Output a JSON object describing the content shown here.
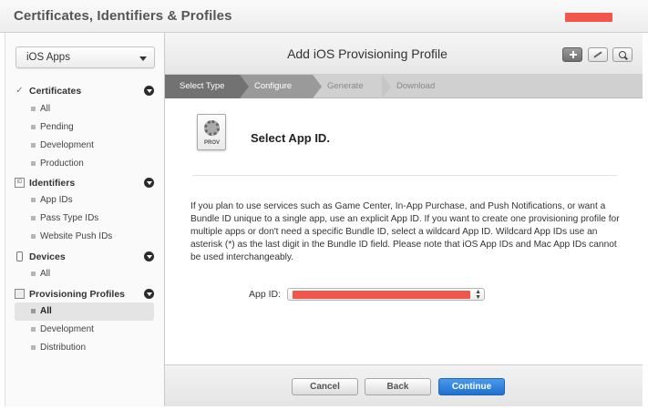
{
  "header": {
    "title": "Certificates, Identifiers & Profiles"
  },
  "sidebar": {
    "platform_select": "iOS Apps",
    "sections": [
      {
        "label": "Certificates",
        "icon": "certificate-icon",
        "items": [
          "All",
          "Pending",
          "Development",
          "Production"
        ]
      },
      {
        "label": "Identifiers",
        "icon": "id-icon",
        "items": [
          "App IDs",
          "Pass Type IDs",
          "Website Push IDs"
        ]
      },
      {
        "label": "Devices",
        "icon": "device-icon",
        "items": [
          "All"
        ]
      },
      {
        "label": "Provisioning Profiles",
        "icon": "profile-icon",
        "items": [
          "All",
          "Development",
          "Distribution"
        ]
      }
    ],
    "active": "Provisioning Profiles / All"
  },
  "main": {
    "title": "Add iOS Provisioning Profile",
    "steps": [
      "Select Type",
      "Configure",
      "Generate",
      "Download"
    ],
    "icon_tag": "PROV",
    "section_title": "Select App ID.",
    "description": "If you plan to use services such as Game Center, In-App Purchase, and Push Notifications, or want a Bundle ID unique to a single app, use an explicit App ID. If you want to create one provisioning profile for multiple apps or don't need a specific Bundle ID, select a wildcard App ID. Wildcard App IDs use an asterisk (*) as the last digit in the Bundle ID field. Please note that iOS App IDs and Mac App IDs cannot be used interchangeably.",
    "app_id_label": "App ID:"
  },
  "footer": {
    "cancel": "Cancel",
    "back": "Back",
    "continue": "Continue"
  },
  "colors": {
    "accent": "#1f6fd1",
    "redacted": "#f2554a"
  }
}
